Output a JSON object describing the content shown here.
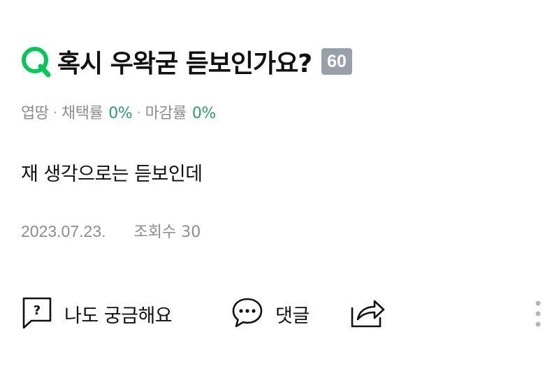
{
  "question": {
    "title": "혹시 우왁굳 듣보인가요?",
    "points": "60",
    "author": "엽땅",
    "adoption_label": "채택률",
    "adoption_rate": "0%",
    "deadline_label": "마감률",
    "deadline_rate": "0%",
    "body": "재 생각으로는 듣보인데",
    "date": "2023.07.23.",
    "views_label": "조회수 30"
  },
  "actions": {
    "curious_label": "나도 궁금해요",
    "comment_label": "댓글"
  },
  "icons": {
    "question_mark": "question-q-icon",
    "curious": "question-bubble-icon",
    "comment": "comment-icon",
    "share": "share-icon",
    "more": "more-vertical-icon"
  },
  "colors": {
    "brand_green": "#03c75a",
    "rate_green": "#2f9c6a",
    "badge_gray": "#9aa0aa",
    "meta_gray": "#8d8d8d"
  }
}
